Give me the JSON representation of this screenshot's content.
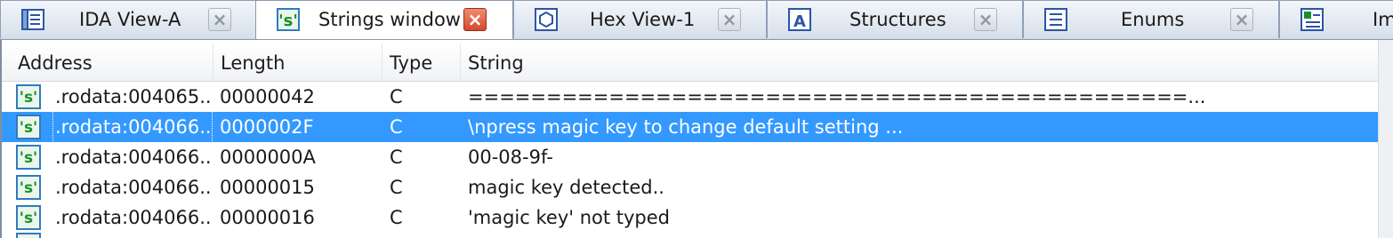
{
  "tabs": [
    {
      "label": "IDA View-A",
      "icon": "ida-view-icon",
      "active": false
    },
    {
      "label": "Strings window",
      "icon": "strings-icon",
      "active": true
    },
    {
      "label": "Hex View-1",
      "icon": "hex-view-icon",
      "active": false
    },
    {
      "label": "Structures",
      "icon": "structures-icon",
      "active": false
    },
    {
      "label": "Enums",
      "icon": "enums-icon",
      "active": false
    },
    {
      "label": "Im",
      "icon": "imports-icon",
      "active": false
    }
  ],
  "tab_close_glyph": "×",
  "columns": [
    "Address",
    "Length",
    "Type",
    "String"
  ],
  "rows": [
    {
      "address": ".rodata:004065...",
      "length": "00000042",
      "type": "C",
      "string": "==============================================..."
    },
    {
      "address": ".rodata:004066...",
      "length": "0000002F",
      "type": "C",
      "string": "\\npress magic key to change default setting ..."
    },
    {
      "address": ".rodata:004066...",
      "length": "0000000A",
      "type": "C",
      "string": "00-08-9f-"
    },
    {
      "address": ".rodata:004066...",
      "length": "00000015",
      "type": "C",
      "string": "magic key detected.."
    },
    {
      "address": ".rodata:004066...",
      "length": "00000016",
      "type": "C",
      "string": "'magic key' not typed"
    }
  ],
  "selected_row_index": 1,
  "colors": {
    "selection": "#3399ff",
    "active_close": "#d24a2e",
    "string_icon_green": "#1a8f2e"
  }
}
